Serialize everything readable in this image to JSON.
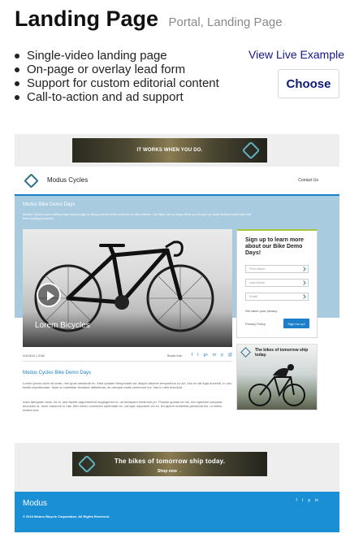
{
  "page": {
    "title": "Landing Page",
    "subtitle": "Portal, Landing Page",
    "features": [
      "Single-video landing page",
      "On-page or overlay lead form",
      "Support for custom editorial content",
      "Call-to-action and ad support"
    ],
    "live_example_label": "View Live Example",
    "choose_label": "Choose"
  },
  "preview": {
    "top_ad_text": "IT WORKS WHEN YOU DO.",
    "nav": {
      "brand": "Modus Cycles",
      "link": "Contact Us"
    },
    "hero": {
      "title": "Modus Bike Demo Days",
      "description": "Modus Cycles uses cutting edge technology to bring you the best products on the market. Our Bike Demo Days allow you to get up close and personal with the best cycling products."
    },
    "video": {
      "title": "Lorem Bicycles",
      "date": "2/4/2014 | 3:08",
      "share_label": "Share this:",
      "share_icons": [
        "f",
        "t",
        "g+",
        "in",
        "p",
        "@"
      ]
    },
    "form": {
      "heading": "Sign up to learn more about our Bike Demo Days!",
      "first_name_placeholder": "First Name",
      "last_name_placeholder": "Last Name",
      "email_placeholder": "Email",
      "privacy_note": "We value your privacy.",
      "privacy_link": "Privacy Policy",
      "submit_label": "Sign me up!"
    },
    "article": {
      "title": "Modus Cycles Bike Demo Days",
      "paragraph_1": "Lorem ipsum dolor sit amet, mei quas salutandi ex. Mea quidam theophrasti ad, aliquid labores temporibus cu ad. Usu ex alii fugit docendi, in usu facilis repudiandae. Nam id molestiae tincidunt definiebas, an utroque malis commune ius, has in nibh tincidunt.",
      "paragraph_2": "Iusto tamquam dolor vix ei, sea facete argumentum neglegentur ei, ne tamquam minimum pri. Possim quodsi ne his, nec aperiam voluptua accusam id, dolor malorum in has. Mel omnio convenire splendide ne, corrupti repudiare vel ex. Ad aperiri urbanitas persecuti his, ut minim mazim eus."
    },
    "side_ad_text": "The bikes of tomorrow ship today.",
    "bottom_ad": {
      "text": "The bikes of tomorrow ship today.",
      "cta": "Shop now →"
    },
    "footer": {
      "brand": "Modus",
      "copyright": "© 2016 Modus Bicycle Corporation. All Rights Reserved.",
      "social_icons": [
        "f",
        "t",
        "p",
        "in"
      ]
    }
  },
  "colors": {
    "brand_blue": "#1b8fd6",
    "link_navy": "#15158a",
    "hero_band": "#a8cbe0",
    "form_accent": "#a8c83c"
  }
}
